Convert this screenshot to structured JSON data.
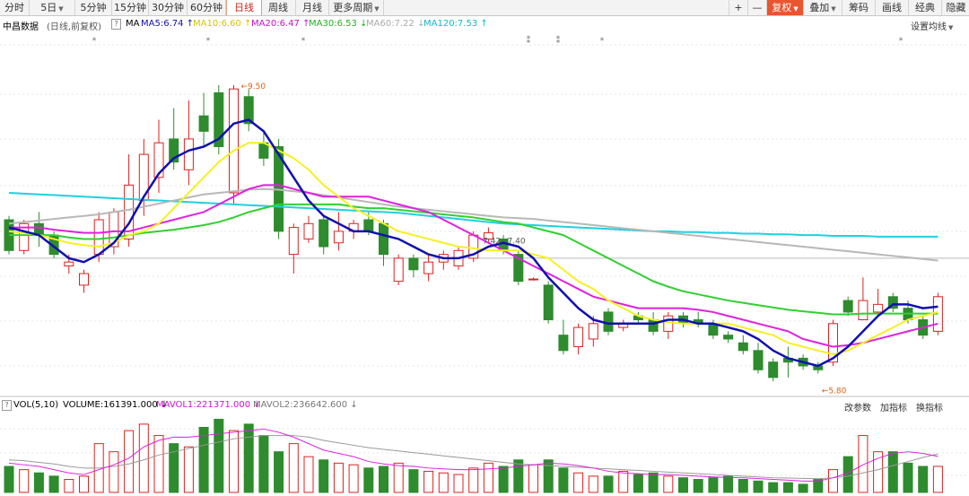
{
  "toolbar": {
    "tabs": [
      {
        "label": "分时",
        "dropdown": false
      },
      {
        "label": "5日",
        "dropdown": true
      },
      {
        "label": "5分钟",
        "dropdown": false
      },
      {
        "label": "15分钟",
        "dropdown": false
      },
      {
        "label": "30分钟",
        "dropdown": false
      },
      {
        "label": "60分钟",
        "dropdown": false
      },
      {
        "label": "日线",
        "dropdown": false,
        "active": true
      },
      {
        "label": "周线",
        "dropdown": false
      },
      {
        "label": "月线",
        "dropdown": false
      },
      {
        "label": "更多周期",
        "dropdown": true
      }
    ],
    "right": {
      "plus": "+",
      "minus": "—",
      "fuquan": "复权",
      "diejia": "叠加",
      "chouma": "筹码",
      "huaxian": "画线",
      "jingdian": "经典",
      "yincang": "隐藏"
    }
  },
  "info": {
    "title": "中昌数据",
    "subtitle": "(日线,前复权)",
    "help": "?",
    "ma_label": "MA",
    "ma5": "MA5:6.74",
    "ma10": "MA10:6.60",
    "ma20": "MA20:6.47",
    "ma30": "MA30:6.53",
    "ma60": "MA60:7.22",
    "ma120": "MA120:7.53",
    "settings": "设置均线"
  },
  "vol_info": {
    "help": "?",
    "label": "VOL(5,10)",
    "volume": "VOLUME:161391.000",
    "mavol1": "MAVOL1:221371.000",
    "mavol2": "MAVOL2:236642.600",
    "btn1": "改参数",
    "btn2": "加指标",
    "btn3": "换指标"
  },
  "colors": {
    "up": "#e02020",
    "down": "#2e8b2e",
    "ma5": "#1010b0",
    "ma10": "#f5f020",
    "ma20": "#e020e0",
    "ma30": "#30d030",
    "ma60": "#b8b8b8",
    "ma120": "#20d0e0",
    "label_orange": "#e06010"
  },
  "chart_data": {
    "type": "candlestick",
    "title": "中昌数据",
    "price_range": [
      5.5,
      10.0
    ],
    "annotations": {
      "high": "9.50",
      "low": "5.80",
      "mid": "7.42~7.40"
    },
    "ref_line": 7.25,
    "candles": [
      [
        7.75,
        7.35,
        7.8,
        7.3
      ],
      [
        7.35,
        7.7,
        7.75,
        7.3
      ],
      [
        7.7,
        7.55,
        7.85,
        7.4
      ],
      [
        7.55,
        7.3,
        7.6,
        7.25
      ],
      [
        7.15,
        7.2,
        7.3,
        7.05
      ],
      [
        6.9,
        7.05,
        7.1,
        6.8
      ],
      [
        7.3,
        7.75,
        7.85,
        7.2
      ],
      [
        7.4,
        7.85,
        7.9,
        7.3
      ],
      [
        7.5,
        8.2,
        8.6,
        7.4
      ],
      [
        8.0,
        8.6,
        8.8,
        7.8
      ],
      [
        8.3,
        8.75,
        9.05,
        8.1
      ],
      [
        8.8,
        8.5,
        9.2,
        8.4
      ],
      [
        8.4,
        8.8,
        9.3,
        8.2
      ],
      [
        9.1,
        8.9,
        9.4,
        8.7
      ],
      [
        9.4,
        8.7,
        9.5,
        8.6
      ],
      [
        8.1,
        9.45,
        9.5,
        7.95
      ],
      [
        9.35,
        9.0,
        9.45,
        8.9
      ],
      [
        8.75,
        8.55,
        8.9,
        8.45
      ],
      [
        8.7,
        7.6,
        8.8,
        7.5
      ],
      [
        7.3,
        7.65,
        7.7,
        7.05
      ],
      [
        7.5,
        7.7,
        7.8,
        7.45
      ],
      [
        7.75,
        7.4,
        7.8,
        7.3
      ],
      [
        7.45,
        7.6,
        7.85,
        7.35
      ],
      [
        7.6,
        7.7,
        7.75,
        7.5
      ],
      [
        7.75,
        7.6,
        7.85,
        7.55
      ],
      [
        7.7,
        7.3,
        7.75,
        7.15
      ],
      [
        6.95,
        7.25,
        7.3,
        6.9
      ],
      [
        7.25,
        7.1,
        7.3,
        7.0
      ],
      [
        7.05,
        7.2,
        7.3,
        6.95
      ],
      [
        7.2,
        7.3,
        7.35,
        7.1
      ],
      [
        7.15,
        7.35,
        7.4,
        7.1
      ],
      [
        7.25,
        7.55,
        7.6,
        7.2
      ],
      [
        7.5,
        7.58,
        7.65,
        7.45
      ],
      [
        7.5,
        7.35,
        7.55,
        7.3
      ],
      [
        7.3,
        6.95,
        7.35,
        6.9
      ],
      [
        6.98,
        6.98,
        7.0,
        6.96
      ],
      [
        6.9,
        6.45,
        6.95,
        6.4
      ],
      [
        6.25,
        6.05,
        6.45,
        6.0
      ],
      [
        6.1,
        6.35,
        6.4,
        6.0
      ],
      [
        6.2,
        6.4,
        6.5,
        6.1
      ],
      [
        6.55,
        6.3,
        6.6,
        6.25
      ],
      [
        6.35,
        6.4,
        6.45,
        6.3
      ],
      [
        6.5,
        6.45,
        6.55,
        6.4
      ],
      [
        6.45,
        6.3,
        6.55,
        6.25
      ],
      [
        6.3,
        6.5,
        6.55,
        6.2
      ],
      [
        6.5,
        6.4,
        6.55,
        6.35
      ],
      [
        6.45,
        6.4,
        6.55,
        6.35
      ],
      [
        6.4,
        6.25,
        6.45,
        6.2
      ],
      [
        6.25,
        6.2,
        6.3,
        6.15
      ],
      [
        6.15,
        6.05,
        6.25,
        6.0
      ],
      [
        6.05,
        5.8,
        6.15,
        5.75
      ],
      [
        5.9,
        5.7,
        5.95,
        5.65
      ],
      [
        5.95,
        5.9,
        6.1,
        5.7
      ],
      [
        5.95,
        5.85,
        6.0,
        5.8
      ],
      [
        5.85,
        5.8,
        5.9,
        5.75
      ],
      [
        5.9,
        6.4,
        6.45,
        5.85
      ],
      [
        6.7,
        6.55,
        6.75,
        6.5
      ],
      [
        6.45,
        6.7,
        7.0,
        6.45
      ],
      [
        6.55,
        6.65,
        6.85,
        6.5
      ],
      [
        6.75,
        6.6,
        6.8,
        6.55
      ],
      [
        6.6,
        6.45,
        6.7,
        6.4
      ],
      [
        6.45,
        6.25,
        6.5,
        6.2
      ],
      [
        6.3,
        6.75,
        6.8,
        6.25
      ]
    ],
    "ma5": [
      7.65,
      7.6,
      7.55,
      7.4,
      7.25,
      7.2,
      7.3,
      7.45,
      7.7,
      8.05,
      8.35,
      8.55,
      8.65,
      8.7,
      8.8,
      9.0,
      9.05,
      8.9,
      8.6,
      8.3,
      8.0,
      7.8,
      7.7,
      7.6,
      7.6,
      7.55,
      7.5,
      7.4,
      7.3,
      7.25,
      7.25,
      7.3,
      7.4,
      7.45,
      7.4,
      7.25,
      7.0,
      6.8,
      6.6,
      6.45,
      6.4,
      6.4,
      6.4,
      6.4,
      6.45,
      6.45,
      6.4,
      6.4,
      6.35,
      6.3,
      6.2,
      6.05,
      5.95,
      5.9,
      5.85,
      5.95,
      6.1,
      6.3,
      6.5,
      6.65,
      6.65,
      6.6,
      6.62
    ],
    "ma10": [
      7.6,
      7.58,
      7.55,
      7.5,
      7.45,
      7.42,
      7.4,
      7.45,
      7.55,
      7.6,
      7.7,
      7.9,
      8.1,
      8.3,
      8.5,
      8.65,
      8.75,
      8.75,
      8.65,
      8.55,
      8.4,
      8.2,
      8.05,
      7.9,
      7.8,
      7.7,
      7.6,
      7.55,
      7.5,
      7.45,
      7.4,
      7.38,
      7.35,
      7.35,
      7.35,
      7.3,
      7.25,
      7.1,
      6.95,
      6.85,
      6.7,
      6.6,
      6.5,
      6.45,
      6.42,
      6.4,
      6.4,
      6.4,
      6.4,
      6.35,
      6.3,
      6.25,
      6.15,
      6.1,
      6.05,
      6.0,
      6.05,
      6.15,
      6.25,
      6.35,
      6.45,
      6.5,
      6.55
    ],
    "ma20": [
      7.65,
      7.65,
      7.65,
      7.62,
      7.6,
      7.58,
      7.58,
      7.6,
      7.6,
      7.65,
      7.7,
      7.75,
      7.8,
      7.85,
      7.95,
      8.05,
      8.15,
      8.2,
      8.2,
      8.15,
      8.1,
      8.05,
      8.05,
      8.05,
      8.05,
      8.0,
      7.95,
      7.9,
      7.85,
      7.75,
      7.65,
      7.55,
      7.45,
      7.35,
      7.25,
      7.15,
      7.05,
      6.95,
      6.85,
      6.75,
      6.7,
      6.65,
      6.6,
      6.6,
      6.6,
      6.6,
      6.58,
      6.55,
      6.5,
      6.45,
      6.4,
      6.35,
      6.3,
      6.2,
      6.15,
      6.1,
      6.12,
      6.15,
      6.2,
      6.25,
      6.3,
      6.35,
      6.4
    ],
    "ma30": [
      7.55,
      7.55,
      7.55,
      7.55,
      7.52,
      7.5,
      7.5,
      7.52,
      7.55,
      7.58,
      7.6,
      7.62,
      7.65,
      7.68,
      7.72,
      7.78,
      7.85,
      7.9,
      7.95,
      7.95,
      7.95,
      7.95,
      7.95,
      7.92,
      7.9,
      7.9,
      7.88,
      7.86,
      7.84,
      7.82,
      7.8,
      7.78,
      7.75,
      7.72,
      7.7,
      7.65,
      7.6,
      7.55,
      7.45,
      7.35,
      7.25,
      7.15,
      7.05,
      6.95,
      6.88,
      6.82,
      6.78,
      6.74,
      6.7,
      6.67,
      6.64,
      6.61,
      6.58,
      6.56,
      6.54,
      6.52,
      6.52,
      6.53,
      6.53,
      6.53,
      6.53,
      6.53,
      6.53
    ],
    "ma60": [
      7.7,
      7.72,
      7.74,
      7.76,
      7.78,
      7.8,
      7.82,
      7.85,
      7.88,
      7.92,
      7.96,
      8.0,
      8.04,
      8.08,
      8.1,
      8.12,
      8.14,
      8.15,
      8.14,
      8.12,
      8.1,
      8.07,
      8.04,
      8.01,
      7.98,
      7.95,
      7.92,
      7.9,
      7.88,
      7.86,
      7.84,
      7.82,
      7.8,
      7.78,
      7.77,
      7.76,
      7.74,
      7.72,
      7.7,
      7.68,
      7.66,
      7.64,
      7.62,
      7.6,
      7.58,
      7.56,
      7.54,
      7.52,
      7.5,
      7.48,
      7.46,
      7.44,
      7.42,
      7.4,
      7.38,
      7.36,
      7.34,
      7.32,
      7.3,
      7.28,
      7.26,
      7.24,
      7.22
    ],
    "ma120": [
      8.1,
      8.09,
      8.08,
      8.07,
      8.06,
      8.05,
      8.04,
      8.03,
      8.02,
      8.01,
      8.0,
      7.99,
      7.98,
      7.97,
      7.96,
      7.95,
      7.94,
      7.93,
      7.92,
      7.91,
      7.9,
      7.89,
      7.88,
      7.87,
      7.86,
      7.85,
      7.84,
      7.82,
      7.8,
      7.78,
      7.76,
      7.74,
      7.72,
      7.7,
      7.69,
      7.68,
      7.67,
      7.66,
      7.65,
      7.64,
      7.63,
      7.62,
      7.61,
      7.6,
      7.6,
      7.59,
      7.59,
      7.58,
      7.58,
      7.57,
      7.57,
      7.56,
      7.56,
      7.55,
      7.55,
      7.54,
      7.54,
      7.54,
      7.53,
      7.53,
      7.53,
      7.53,
      7.53
    ],
    "volume_range": [
      0,
      480000
    ],
    "volumes": [
      160000,
      140000,
      120000,
      100000,
      80000,
      100000,
      300000,
      250000,
      380000,
      420000,
      350000,
      300000,
      280000,
      400000,
      450000,
      380000,
      420000,
      350000,
      250000,
      300000,
      220000,
      200000,
      180000,
      170000,
      150000,
      160000,
      180000,
      140000,
      130000,
      120000,
      110000,
      150000,
      180000,
      160000,
      200000,
      170000,
      200000,
      150000,
      120000,
      100000,
      100000,
      130000,
      110000,
      120000,
      100000,
      90000,
      80000,
      90000,
      100000,
      80000,
      70000,
      60000,
      60000,
      50000,
      80000,
      140000,
      220000,
      350000,
      250000,
      250000,
      180000,
      160000,
      160000
    ],
    "mavol1": [
      180000,
      170000,
      160000,
      140000,
      120000,
      110000,
      140000,
      170000,
      210000,
      280000,
      320000,
      340000,
      340000,
      350000,
      360000,
      370000,
      380000,
      390000,
      370000,
      340000,
      300000,
      260000,
      240000,
      220000,
      190000,
      175000,
      165000,
      160000,
      150000,
      145000,
      140000,
      140000,
      145000,
      150000,
      160000,
      170000,
      180000,
      175000,
      165000,
      150000,
      130000,
      120000,
      115000,
      110000,
      110000,
      105000,
      100000,
      95000,
      92000,
      90000,
      85000,
      80000,
      75000,
      70000,
      70000,
      90000,
      120000,
      170000,
      210000,
      240000,
      250000,
      240000,
      221371
    ],
    "mavol2": [
      200000,
      195000,
      185000,
      175000,
      160000,
      150000,
      150000,
      160000,
      175000,
      200000,
      230000,
      250000,
      270000,
      290000,
      310000,
      330000,
      340000,
      350000,
      350000,
      350000,
      340000,
      320000,
      305000,
      290000,
      275000,
      265000,
      255000,
      245000,
      235000,
      225000,
      215000,
      205000,
      195000,
      185000,
      175000,
      170000,
      165000,
      160000,
      155000,
      150000,
      145000,
      140000,
      135000,
      130000,
      125000,
      120000,
      115000,
      110000,
      105000,
      100000,
      95000,
      90000,
      88000,
      86000,
      84000,
      90000,
      100000,
      120000,
      140000,
      165000,
      190000,
      215000,
      236642
    ]
  }
}
